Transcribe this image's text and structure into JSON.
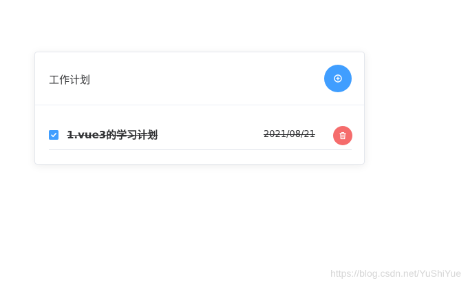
{
  "card": {
    "title": "工作计划"
  },
  "todos": [
    {
      "text": "1.vue3的学习计划",
      "date": "2021/08/21",
      "completed": true
    }
  ],
  "icons": {
    "add": "plus-circle-icon",
    "check": "check-icon",
    "delete": "trash-icon"
  },
  "colors": {
    "primary": "#409eff",
    "danger": "#f56c6c",
    "text": "#303133",
    "border": "#e4e7ed"
  },
  "watermark": "https://blog.csdn.net/YuShiYue"
}
